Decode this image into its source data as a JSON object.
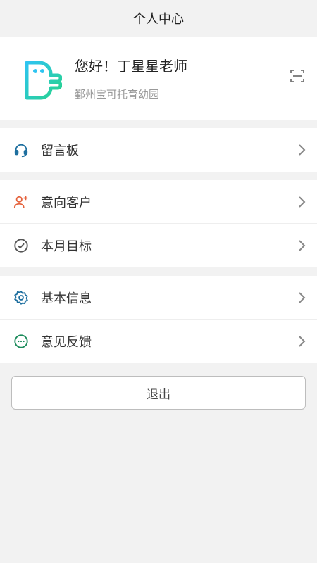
{
  "header": {
    "title": "个人中心"
  },
  "profile": {
    "greeting": "您好！丁星星老师",
    "school": "鄞州宝可托育幼园",
    "logo_icon": "brand-logo",
    "scan_icon": "scan-icon"
  },
  "menu": {
    "group1": [
      {
        "label": "留言板",
        "icon": "headset-icon",
        "color": "#1e6f9f"
      }
    ],
    "group2": [
      {
        "label": "意向客户",
        "icon": "add-person-icon",
        "color": "#e5623c"
      },
      {
        "label": "本月目标",
        "icon": "check-circle-icon",
        "color": "#555555"
      }
    ],
    "group3": [
      {
        "label": "基本信息",
        "icon": "gear-icon",
        "color": "#1e6f9f"
      },
      {
        "label": "意见反馈",
        "icon": "chat-dots-icon",
        "color": "#1a8a5a"
      }
    ]
  },
  "logout": {
    "label": "退出"
  }
}
